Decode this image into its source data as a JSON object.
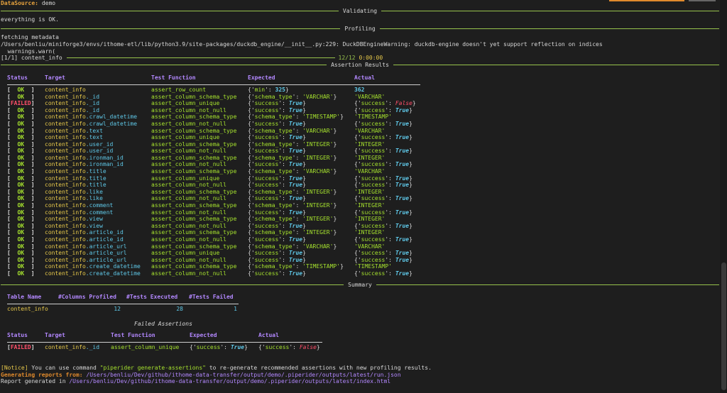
{
  "header": {
    "datasource_key": "DataSource:",
    "datasource_value": "demo"
  },
  "validating": {
    "title": "Validating",
    "message": "everything is OK."
  },
  "profiling": {
    "title": "Profiling",
    "lines": [
      "fetching metadata",
      "/Users/benliu/miniforge3/envs/ithome-etl/lib/python3.9/site-packages/duckdb_engine/__init__.py:229: DuckDBEngineWarning: duckdb-engine doesn't yet support reflection on indices",
      "  warnings.warn("
    ],
    "progress_label": "[1/1] content_info",
    "progress_count": "12/12",
    "progress_time": "0:00:00"
  },
  "assertion_results": {
    "title": "Assertion Results",
    "columns": [
      "Status",
      "Target",
      "Test Function",
      "Expected",
      "Actual"
    ],
    "rows": [
      {
        "status": "OK",
        "target": "content_info",
        "sub": "",
        "fn": "assert_row_count",
        "expected": {
          "key": "min",
          "val": "325",
          "type": "num"
        },
        "actual": {
          "type": "num",
          "val": "362"
        }
      },
      {
        "status": "OK",
        "target": "content_info",
        "sub": "._id",
        "fn": "assert_column_schema_type",
        "expected": {
          "key": "schema_type",
          "val": "'VARCHAR'",
          "type": "str"
        },
        "actual": {
          "type": "str",
          "val": "'VARCHAR'"
        }
      },
      {
        "status": "FAILED",
        "target": "content_info",
        "sub": "._id",
        "fn": "assert_column_unique",
        "expected": {
          "key": "success",
          "val": "True",
          "type": "bool"
        },
        "actual": {
          "type": "dict",
          "key": "success",
          "val": "False"
        }
      },
      {
        "status": "OK",
        "target": "content_info",
        "sub": "._id",
        "fn": "assert_column_not_null",
        "expected": {
          "key": "success",
          "val": "True",
          "type": "bool"
        },
        "actual": {
          "type": "dict",
          "key": "success",
          "val": "True"
        }
      },
      {
        "status": "OK",
        "target": "content_info",
        "sub": ".crawl_datetime",
        "fn": "assert_column_schema_type",
        "expected": {
          "key": "schema_type",
          "val": "'TIMESTAMP'",
          "type": "str"
        },
        "actual": {
          "type": "str",
          "val": "'TIMESTAMP'"
        }
      },
      {
        "status": "OK",
        "target": "content_info",
        "sub": ".crawl_datetime",
        "fn": "assert_column_not_null",
        "expected": {
          "key": "success",
          "val": "True",
          "type": "bool"
        },
        "actual": {
          "type": "dict",
          "key": "success",
          "val": "True"
        }
      },
      {
        "status": "OK",
        "target": "content_info",
        "sub": ".text",
        "fn": "assert_column_schema_type",
        "expected": {
          "key": "schema_type",
          "val": "'VARCHAR'",
          "type": "str"
        },
        "actual": {
          "type": "str",
          "val": "'VARCHAR'"
        }
      },
      {
        "status": "OK",
        "target": "content_info",
        "sub": ".text",
        "fn": "assert_column_unique",
        "expected": {
          "key": "success",
          "val": "True",
          "type": "bool"
        },
        "actual": {
          "type": "dict",
          "key": "success",
          "val": "True"
        }
      },
      {
        "status": "OK",
        "target": "content_info",
        "sub": ".user_id",
        "fn": "assert_column_schema_type",
        "expected": {
          "key": "schema_type",
          "val": "'INTEGER'",
          "type": "str"
        },
        "actual": {
          "type": "str",
          "val": "'INTEGER'"
        }
      },
      {
        "status": "OK",
        "target": "content_info",
        "sub": ".user_id",
        "fn": "assert_column_not_null",
        "expected": {
          "key": "success",
          "val": "True",
          "type": "bool"
        },
        "actual": {
          "type": "dict",
          "key": "success",
          "val": "True"
        }
      },
      {
        "status": "OK",
        "target": "content_info",
        "sub": ".ironman_id",
        "fn": "assert_column_schema_type",
        "expected": {
          "key": "schema_type",
          "val": "'INTEGER'",
          "type": "str"
        },
        "actual": {
          "type": "str",
          "val": "'INTEGER'"
        }
      },
      {
        "status": "OK",
        "target": "content_info",
        "sub": ".ironman_id",
        "fn": "assert_column_not_null",
        "expected": {
          "key": "success",
          "val": "True",
          "type": "bool"
        },
        "actual": {
          "type": "dict",
          "key": "success",
          "val": "True"
        }
      },
      {
        "status": "OK",
        "target": "content_info",
        "sub": ".title",
        "fn": "assert_column_schema_type",
        "expected": {
          "key": "schema_type",
          "val": "'VARCHAR'",
          "type": "str"
        },
        "actual": {
          "type": "str",
          "val": "'VARCHAR'"
        }
      },
      {
        "status": "OK",
        "target": "content_info",
        "sub": ".title",
        "fn": "assert_column_unique",
        "expected": {
          "key": "success",
          "val": "True",
          "type": "bool"
        },
        "actual": {
          "type": "dict",
          "key": "success",
          "val": "True"
        }
      },
      {
        "status": "OK",
        "target": "content_info",
        "sub": ".title",
        "fn": "assert_column_not_null",
        "expected": {
          "key": "success",
          "val": "True",
          "type": "bool"
        },
        "actual": {
          "type": "dict",
          "key": "success",
          "val": "True"
        }
      },
      {
        "status": "OK",
        "target": "content_info",
        "sub": ".like",
        "fn": "assert_column_schema_type",
        "expected": {
          "key": "schema_type",
          "val": "'INTEGER'",
          "type": "str"
        },
        "actual": {
          "type": "str",
          "val": "'INTEGER'"
        }
      },
      {
        "status": "OK",
        "target": "content_info",
        "sub": ".like",
        "fn": "assert_column_not_null",
        "expected": {
          "key": "success",
          "val": "True",
          "type": "bool"
        },
        "actual": {
          "type": "dict",
          "key": "success",
          "val": "True"
        }
      },
      {
        "status": "OK",
        "target": "content_info",
        "sub": ".comment",
        "fn": "assert_column_schema_type",
        "expected": {
          "key": "schema_type",
          "val": "'INTEGER'",
          "type": "str"
        },
        "actual": {
          "type": "str",
          "val": "'INTEGER'"
        }
      },
      {
        "status": "OK",
        "target": "content_info",
        "sub": ".comment",
        "fn": "assert_column_not_null",
        "expected": {
          "key": "success",
          "val": "True",
          "type": "bool"
        },
        "actual": {
          "type": "dict",
          "key": "success",
          "val": "True"
        }
      },
      {
        "status": "OK",
        "target": "content_info",
        "sub": ".view",
        "fn": "assert_column_schema_type",
        "expected": {
          "key": "schema_type",
          "val": "'INTEGER'",
          "type": "str"
        },
        "actual": {
          "type": "str",
          "val": "'INTEGER'"
        }
      },
      {
        "status": "OK",
        "target": "content_info",
        "sub": ".view",
        "fn": "assert_column_not_null",
        "expected": {
          "key": "success",
          "val": "True",
          "type": "bool"
        },
        "actual": {
          "type": "dict",
          "key": "success",
          "val": "True"
        }
      },
      {
        "status": "OK",
        "target": "content_info",
        "sub": ".article_id",
        "fn": "assert_column_schema_type",
        "expected": {
          "key": "schema_type",
          "val": "'INTEGER'",
          "type": "str"
        },
        "actual": {
          "type": "str",
          "val": "'INTEGER'"
        }
      },
      {
        "status": "OK",
        "target": "content_info",
        "sub": ".article_id",
        "fn": "assert_column_not_null",
        "expected": {
          "key": "success",
          "val": "True",
          "type": "bool"
        },
        "actual": {
          "type": "dict",
          "key": "success",
          "val": "True"
        }
      },
      {
        "status": "OK",
        "target": "content_info",
        "sub": ".article_url",
        "fn": "assert_column_schema_type",
        "expected": {
          "key": "schema_type",
          "val": "'VARCHAR'",
          "type": "str"
        },
        "actual": {
          "type": "str",
          "val": "'VARCHAR'"
        }
      },
      {
        "status": "OK",
        "target": "content_info",
        "sub": ".article_url",
        "fn": "assert_column_unique",
        "expected": {
          "key": "success",
          "val": "True",
          "type": "bool"
        },
        "actual": {
          "type": "dict",
          "key": "success",
          "val": "True"
        }
      },
      {
        "status": "OK",
        "target": "content_info",
        "sub": ".article_url",
        "fn": "assert_column_not_null",
        "expected": {
          "key": "success",
          "val": "True",
          "type": "bool"
        },
        "actual": {
          "type": "dict",
          "key": "success",
          "val": "True"
        }
      },
      {
        "status": "OK",
        "target": "content_info",
        "sub": ".create_datetime",
        "fn": "assert_column_schema_type",
        "expected": {
          "key": "schema_type",
          "val": "'TIMESTAMP'",
          "type": "str"
        },
        "actual": {
          "type": "str",
          "val": "'TIMESTAMP'"
        }
      },
      {
        "status": "OK",
        "target": "content_info",
        "sub": ".create_datetime",
        "fn": "assert_column_not_null",
        "expected": {
          "key": "success",
          "val": "True",
          "type": "bool"
        },
        "actual": {
          "type": "dict",
          "key": "success",
          "val": "True"
        }
      }
    ]
  },
  "summary": {
    "title": "Summary",
    "columns": [
      "Table Name",
      "#Columns Profiled",
      "#Tests Executed",
      "#Tests Failed"
    ],
    "row": {
      "table": "content_info",
      "profiled": "12",
      "executed": "28",
      "failed": "1"
    },
    "failed_title": "Failed Assertions",
    "failed_columns": [
      "Status",
      "Target",
      "Test Function",
      "Expected",
      "Actual"
    ],
    "failed_row": {
      "status": "FAILED",
      "target": "content_info",
      "sub": "._id",
      "fn": "assert_column_unique",
      "expected_key": "success",
      "expected_val": "True",
      "actual_key": "success",
      "actual_val": "False"
    }
  },
  "footer": {
    "notice_tag": "[Notice]",
    "notice_pre": " You can use command ",
    "notice_cmd": "\"piperider generate-assertions\"",
    "notice_post": " to re-generate recommended assertions with new profiling results.",
    "gen_label": "Generating reports from:",
    "gen_path": "/Users/benliu/Dev/github/ithome-data-transfer/output/demo/.piperider/outputs/latest/run.json",
    "report_label": "Report generated in",
    "report_path": "/Users/benliu/Dev/github/ithome-data-transfer/output/demo/.piperider/outputs/latest/index.html"
  },
  "colors": {
    "background": "#1e1e1e",
    "ok": "#a6e22e",
    "failed": "#ff4f6a",
    "header": "#b388ff",
    "target": "#e6c84a",
    "number": "#5fc8e8",
    "rule": "#97c24c"
  }
}
